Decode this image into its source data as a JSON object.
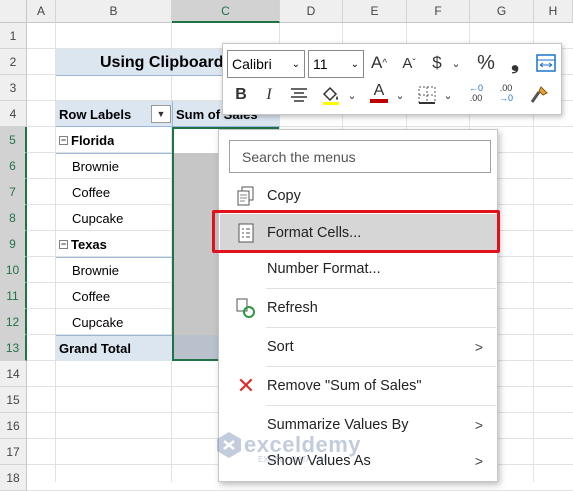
{
  "columns": [
    "A",
    "B",
    "C",
    "D",
    "E",
    "F",
    "G",
    "H"
  ],
  "rows": [
    "1",
    "2",
    "3",
    "4",
    "5",
    "6",
    "7",
    "8",
    "9",
    "10",
    "11",
    "12",
    "13",
    "14",
    "15",
    "16",
    "17",
    "18"
  ],
  "title": "Using Clipboard",
  "pivot": {
    "row_labels_header": "Row Labels",
    "values_header": "Sum of Sales",
    "filter_icon": "dropdown-arrow",
    "groups": [
      {
        "name": "Florida",
        "items": [
          "Brownie",
          "Coffee",
          "Cupcake"
        ]
      },
      {
        "name": "Texas",
        "items": [
          "Brownie",
          "Coffee",
          "Cupcake"
        ]
      }
    ],
    "grand_total": "Grand Total",
    "collapse_symbol": "−"
  },
  "mini_toolbar": {
    "font": "Calibri",
    "size": "11",
    "grow_font": "A",
    "shrink_font": "A",
    "currency": "$",
    "percent": "%",
    "comma": "❟",
    "bold": "B",
    "italic": "I",
    "font_color": "A",
    "increase_decimal": ".00",
    "decrease_decimal": ".00"
  },
  "context_menu": {
    "search_placeholder": "Search the menus",
    "items": [
      {
        "label": "Copy",
        "icon": "copy-icon"
      },
      {
        "label": "Format Cells...",
        "icon": "format-cells-icon",
        "highlighted": true
      },
      {
        "label": "Number Format...",
        "icon": ""
      },
      {
        "label": "Refresh",
        "icon": "refresh-icon"
      },
      {
        "label": "Sort",
        "icon": "",
        "submenu": true
      },
      {
        "label": "Remove \"Sum of Sales\"",
        "icon": "remove-icon"
      },
      {
        "label": "Summarize Values By",
        "icon": "",
        "submenu": true
      },
      {
        "label": "Show Values As",
        "icon": "",
        "submenu": true
      }
    ]
  },
  "watermark": {
    "name": "exceldemy",
    "tagline": "EXCEL · DATA · BI"
  },
  "colors": {
    "accent_green": "#217346",
    "pivot_blue": "#dce6f1",
    "highlight_red": "#e0121d"
  }
}
